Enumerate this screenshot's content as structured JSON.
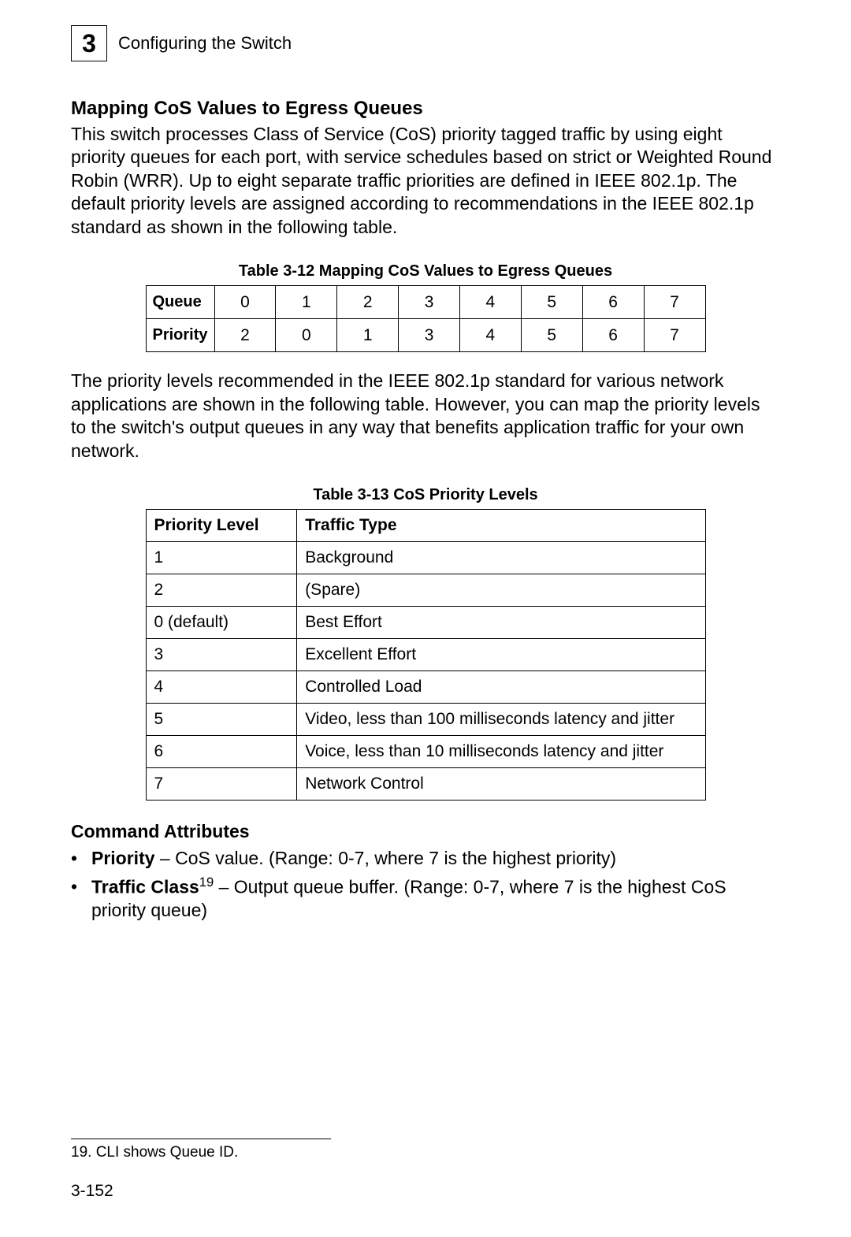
{
  "chapter": {
    "number": "3",
    "title": "Configuring the Switch"
  },
  "section": {
    "heading": "Mapping CoS Values to Egress Queues",
    "intro": "This switch processes Class of Service (CoS) priority tagged traffic by using eight priority queues for each port, with service schedules based on strict or Weighted Round Robin (WRR). Up to eight separate traffic priorities are defined in IEEE 802.1p. The default priority levels are assigned according to recommendations in the IEEE 802.1p standard as shown in the following table."
  },
  "table_map": {
    "caption": "Table 3-12   Mapping CoS Values to Egress Queues",
    "row1_label": "Queue",
    "row2_label": "Priority",
    "columns": [
      "0",
      "1",
      "2",
      "3",
      "4",
      "5",
      "6",
      "7"
    ],
    "queue": [
      "0",
      "1",
      "2",
      "3",
      "4",
      "5",
      "6",
      "7"
    ],
    "priority": [
      "2",
      "0",
      "1",
      "3",
      "4",
      "5",
      "6",
      "7"
    ]
  },
  "mid_text": "The priority levels recommended in the IEEE 802.1p standard for various network applications are shown in the following table. However, you can map the priority levels to the switch's output queues in any way that benefits application traffic for your own network.",
  "table_prio": {
    "caption": "Table 3-13   CoS Priority Levels",
    "headers": {
      "col1": "Priority Level",
      "col2": "Traffic Type"
    },
    "rows": [
      {
        "level": "1",
        "type": "Background"
      },
      {
        "level": "2",
        "type": "(Spare)"
      },
      {
        "level": "0 (default)",
        "type": "Best Effort"
      },
      {
        "level": "3",
        "type": "Excellent Effort"
      },
      {
        "level": "4",
        "type": "Controlled Load"
      },
      {
        "level": "5",
        "type": "Video, less than 100 milliseconds latency and jitter"
      },
      {
        "level": "6",
        "type": "Voice, less than 10 milliseconds latency and jitter"
      },
      {
        "level": "7",
        "type": "Network Control"
      }
    ]
  },
  "command_attributes": {
    "heading": "Command Attributes",
    "items": [
      {
        "term": "Priority",
        "text": " – CoS value. (Range: 0-7, where 7 is the highest priority)",
        "sup": ""
      },
      {
        "term": "Traffic Class",
        "sup": "19",
        "text": " – Output queue buffer. (Range: 0-7, where 7 is the highest CoS priority queue)"
      }
    ]
  },
  "footnote": {
    "marker": "19.",
    "text": " CLI shows Queue ID."
  },
  "page_number": "3-152",
  "chart_data": [
    {
      "type": "table",
      "title": "Table 3-12 Mapping CoS Values to Egress Queues",
      "columns": [
        "Queue",
        "Priority"
      ],
      "rows": [
        {
          "Queue": 0,
          "Priority": 2
        },
        {
          "Queue": 1,
          "Priority": 0
        },
        {
          "Queue": 2,
          "Priority": 1
        },
        {
          "Queue": 3,
          "Priority": 3
        },
        {
          "Queue": 4,
          "Priority": 4
        },
        {
          "Queue": 5,
          "Priority": 5
        },
        {
          "Queue": 6,
          "Priority": 6
        },
        {
          "Queue": 7,
          "Priority": 7
        }
      ]
    },
    {
      "type": "table",
      "title": "Table 3-13 CoS Priority Levels",
      "columns": [
        "Priority Level",
        "Traffic Type"
      ],
      "rows": [
        {
          "Priority Level": "1",
          "Traffic Type": "Background"
        },
        {
          "Priority Level": "2",
          "Traffic Type": "(Spare)"
        },
        {
          "Priority Level": "0 (default)",
          "Traffic Type": "Best Effort"
        },
        {
          "Priority Level": "3",
          "Traffic Type": "Excellent Effort"
        },
        {
          "Priority Level": "4",
          "Traffic Type": "Controlled Load"
        },
        {
          "Priority Level": "5",
          "Traffic Type": "Video, less than 100 milliseconds latency and jitter"
        },
        {
          "Priority Level": "6",
          "Traffic Type": "Voice, less than 10 milliseconds latency and jitter"
        },
        {
          "Priority Level": "7",
          "Traffic Type": "Network Control"
        }
      ]
    }
  ]
}
